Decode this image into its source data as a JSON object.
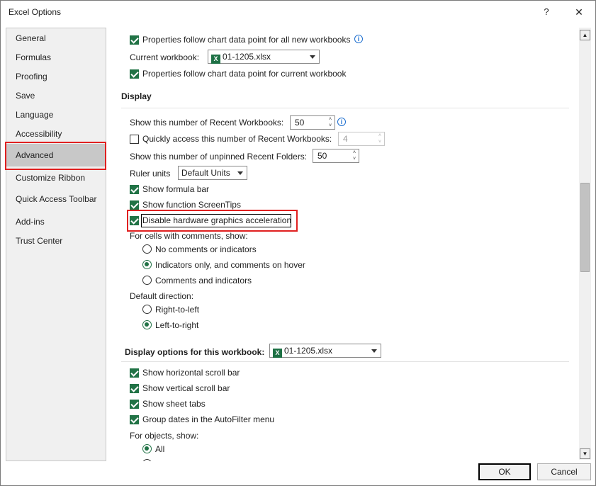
{
  "window": {
    "title": "Excel Options",
    "help_label": "?",
    "close_label": "✕"
  },
  "sidebar": {
    "items": [
      {
        "label": "General"
      },
      {
        "label": "Formulas"
      },
      {
        "label": "Proofing"
      },
      {
        "label": "Save"
      },
      {
        "label": "Language"
      },
      {
        "label": "Accessibility"
      },
      {
        "label": "Advanced",
        "active": true
      },
      {
        "label": "Customize Ribbon"
      },
      {
        "label": "Quick Access Toolbar"
      },
      {
        "label": "Add-ins"
      },
      {
        "label": "Trust Center"
      }
    ]
  },
  "charts": {
    "new_workbooks_label": "Properties follow chart data point for all new workbooks",
    "current_workbook_label": "Current workbook:",
    "current_workbook_value": "01-1205.xlsx",
    "current_workbook_props_label": "Properties follow chart data point for current workbook"
  },
  "display": {
    "header": "Display",
    "recent_workbooks_label": "Show this number of Recent Workbooks:",
    "recent_workbooks_value": "50",
    "quick_access_label": "Quickly access this number of Recent Workbooks:",
    "quick_access_value": "4",
    "unpinned_folders_label": "Show this number of unpinned Recent Folders:",
    "unpinned_folders_value": "50",
    "ruler_units_label": "Ruler units",
    "ruler_units_value": "Default Units",
    "formula_bar_label": "Show formula bar",
    "screentips_label": "Show function ScreenTips",
    "hw_accel_label": "Disable hardware graphics acceleration",
    "comments_label": "For cells with comments, show:",
    "comments_options": [
      {
        "label": "No comments or indicators",
        "selected": false
      },
      {
        "label": "Indicators only, and comments on hover",
        "selected": true
      },
      {
        "label": "Comments and indicators",
        "selected": false
      }
    ],
    "direction_label": "Default direction:",
    "direction_options": [
      {
        "label": "Right-to-left",
        "selected": false
      },
      {
        "label": "Left-to-right",
        "selected": true
      }
    ]
  },
  "workbook_display": {
    "header": "Display options for this workbook:",
    "workbook_value": "01-1205.xlsx",
    "h_scroll_label": "Show horizontal scroll bar",
    "v_scroll_label": "Show vertical scroll bar",
    "sheet_tabs_label": "Show sheet tabs",
    "group_dates_label": "Group dates in the AutoFilter menu",
    "objects_label": "For objects, show:",
    "objects_all_label": "All"
  },
  "footer": {
    "ok_label": "OK",
    "cancel_label": "Cancel"
  },
  "icons": {
    "excel_file_icon_glyph": "X",
    "info_icon_glyph": "i",
    "scroll_up_glyph": "▲",
    "scroll_down_glyph": "▼",
    "spin_up_glyph": "˄",
    "spin_down_glyph": "˅"
  },
  "colors": {
    "accent_green": "#217346",
    "highlight_red": "#e02020",
    "excel_icon": "#1e7145"
  }
}
